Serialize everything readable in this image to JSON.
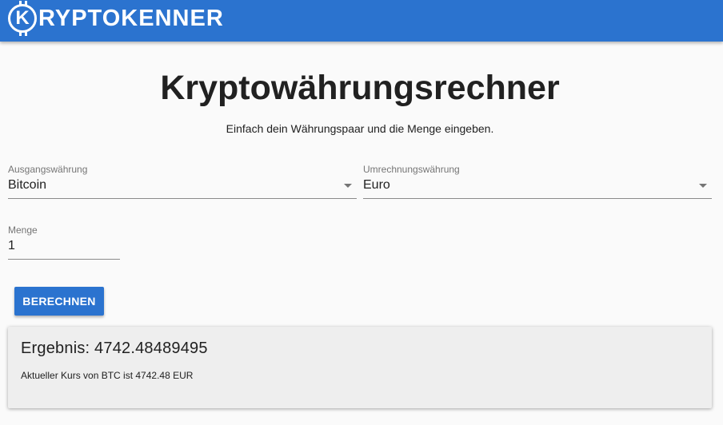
{
  "header": {
    "logo_letter": "K",
    "logo_text": "RYPTOKENNER",
    "color": "#2b73cf"
  },
  "main": {
    "title": "Kryptowährungsrechner",
    "subtitle": "Einfach dein Währungspaar und die Menge eingeben."
  },
  "form": {
    "from": {
      "label": "Ausgangswährung",
      "value": "Bitcoin"
    },
    "to": {
      "label": "Umrechnungswährung",
      "value": "Euro"
    },
    "amount": {
      "label": "Menge",
      "value": "1"
    },
    "calculate_label": "BERECHNEN"
  },
  "result": {
    "title": "Ergebnis: 4742.48489495",
    "note": "Aktueller Kurs von BTC ist 4742.48 EUR"
  }
}
